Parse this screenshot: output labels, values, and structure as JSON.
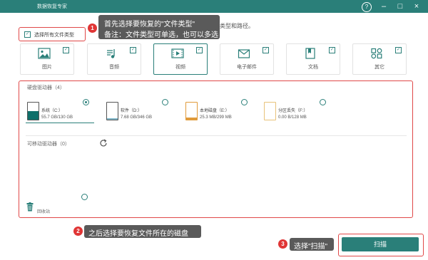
{
  "app": {
    "title": "数据恢复专家"
  },
  "window_controls": {
    "help": "?",
    "minimize": "–",
    "maximize": "□",
    "close": "×"
  },
  "description_tail": "类型和路径。",
  "callouts": [
    {
      "num": "1",
      "line1": "首先选择要恢复的\"文件类型\"",
      "line2": "备注：文件类型可单选，也可以多选"
    },
    {
      "num": "2",
      "text": "之后选择要恢复文件所在的磁盘"
    },
    {
      "num": "3",
      "text": "选择\"扫描\""
    }
  ],
  "select_all": {
    "label": "选择所有文件类型",
    "checked": true
  },
  "file_types": [
    {
      "label": "图片",
      "icon": "image-icon",
      "checked": true,
      "selected": false
    },
    {
      "label": "音频",
      "icon": "audio-icon",
      "checked": true,
      "selected": false
    },
    {
      "label": "视频",
      "icon": "video-icon",
      "checked": true,
      "selected": true
    },
    {
      "label": "电子邮件",
      "icon": "email-icon",
      "checked": true,
      "selected": false
    },
    {
      "label": "文档",
      "icon": "document-icon",
      "checked": true,
      "selected": false
    },
    {
      "label": "其它",
      "icon": "other-icon",
      "checked": true,
      "selected": false
    }
  ],
  "hard_drives": {
    "title": "硬盘驱动器（4）",
    "items": [
      {
        "name": "系统（C:）",
        "size": "55.7 GB/130 GB",
        "selected": true,
        "color": "#0f6f6a"
      },
      {
        "name": "软件（D:）",
        "size": "7.68 GB/346 GB",
        "selected": false,
        "color": "#7fb7c9"
      },
      {
        "name": "本地磁盘（E:）",
        "size": "25.3 MB/299 MB",
        "selected": false,
        "color": "#e09a3a"
      },
      {
        "name": "分区丢失（F:）",
        "size": "0.00  B/128 MB",
        "selected": false,
        "color": "#e8c27a"
      }
    ]
  },
  "removable": {
    "title": "可移动驱动器（0）"
  },
  "recycle_bin": {
    "label": "回收站",
    "selected": false
  },
  "scan_button": {
    "label": "扫描"
  },
  "colors": {
    "accent": "#2a7f79",
    "highlight": "#e04848",
    "callout_bg": "#5a5a5a"
  }
}
